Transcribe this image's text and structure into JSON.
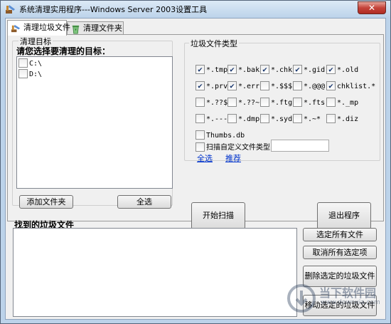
{
  "window": {
    "title": "系统清理实用程序---Windows Server 2003设置工具",
    "close_label": "✕"
  },
  "tabs": [
    {
      "label": "清理垃圾文件",
      "active": true
    },
    {
      "label": "清理文件夹",
      "active": false
    }
  ],
  "target_group": {
    "legend": "清理目标",
    "prompt": "请您选择要清理的目标：",
    "drives": [
      {
        "label": "C:\\",
        "checked": false
      },
      {
        "label": "D:\\",
        "checked": false
      }
    ],
    "add_folder_label": "添加文件夹",
    "select_all_label": "全选"
  },
  "filetype_group": {
    "legend": "垃圾文件类型",
    "types": [
      {
        "label": "*.tmp",
        "checked": true
      },
      {
        "label": "*.bak",
        "checked": true
      },
      {
        "label": "*.chk",
        "checked": true
      },
      {
        "label": "*.gid",
        "checked": true
      },
      {
        "label": "*.old",
        "checked": true
      },
      {
        "label": "*.prv",
        "checked": true
      },
      {
        "label": "*.err",
        "checked": true
      },
      {
        "label": "*.$$$",
        "checked": false
      },
      {
        "label": "*.@@@",
        "checked": false
      },
      {
        "label": "chklist.*",
        "checked": true
      },
      {
        "label": "*.??$",
        "checked": false
      },
      {
        "label": "*.??~",
        "checked": false
      },
      {
        "label": "*.ftg",
        "checked": false
      },
      {
        "label": "*.fts",
        "checked": false
      },
      {
        "label": "*._mp",
        "checked": false
      },
      {
        "label": "*.---",
        "checked": false
      },
      {
        "label": "*.dmp",
        "checked": false
      },
      {
        "label": "*.syd",
        "checked": false
      },
      {
        "label": "*.~*",
        "checked": false
      },
      {
        "label": "*.diz",
        "checked": false
      },
      {
        "label": "Thumbs.db",
        "checked": false
      }
    ],
    "custom_label": "扫描自定义文件类型",
    "custom_checked": false,
    "custom_value": "",
    "select_all_link": "全选",
    "recommend_link": "推荐"
  },
  "actions": {
    "scan_label": "开始扫描",
    "exit_label": "退出程序"
  },
  "found": {
    "label": "找到的垃圾文件",
    "items": [],
    "select_all_label": "选定所有文件",
    "deselect_label": "取消所有选定项",
    "delete_label": "删除选定的垃圾文件",
    "move_label": "移动选定的垃圾文件"
  },
  "watermark": {
    "text": "当下软件园",
    "sub": "www.downxia.com"
  }
}
